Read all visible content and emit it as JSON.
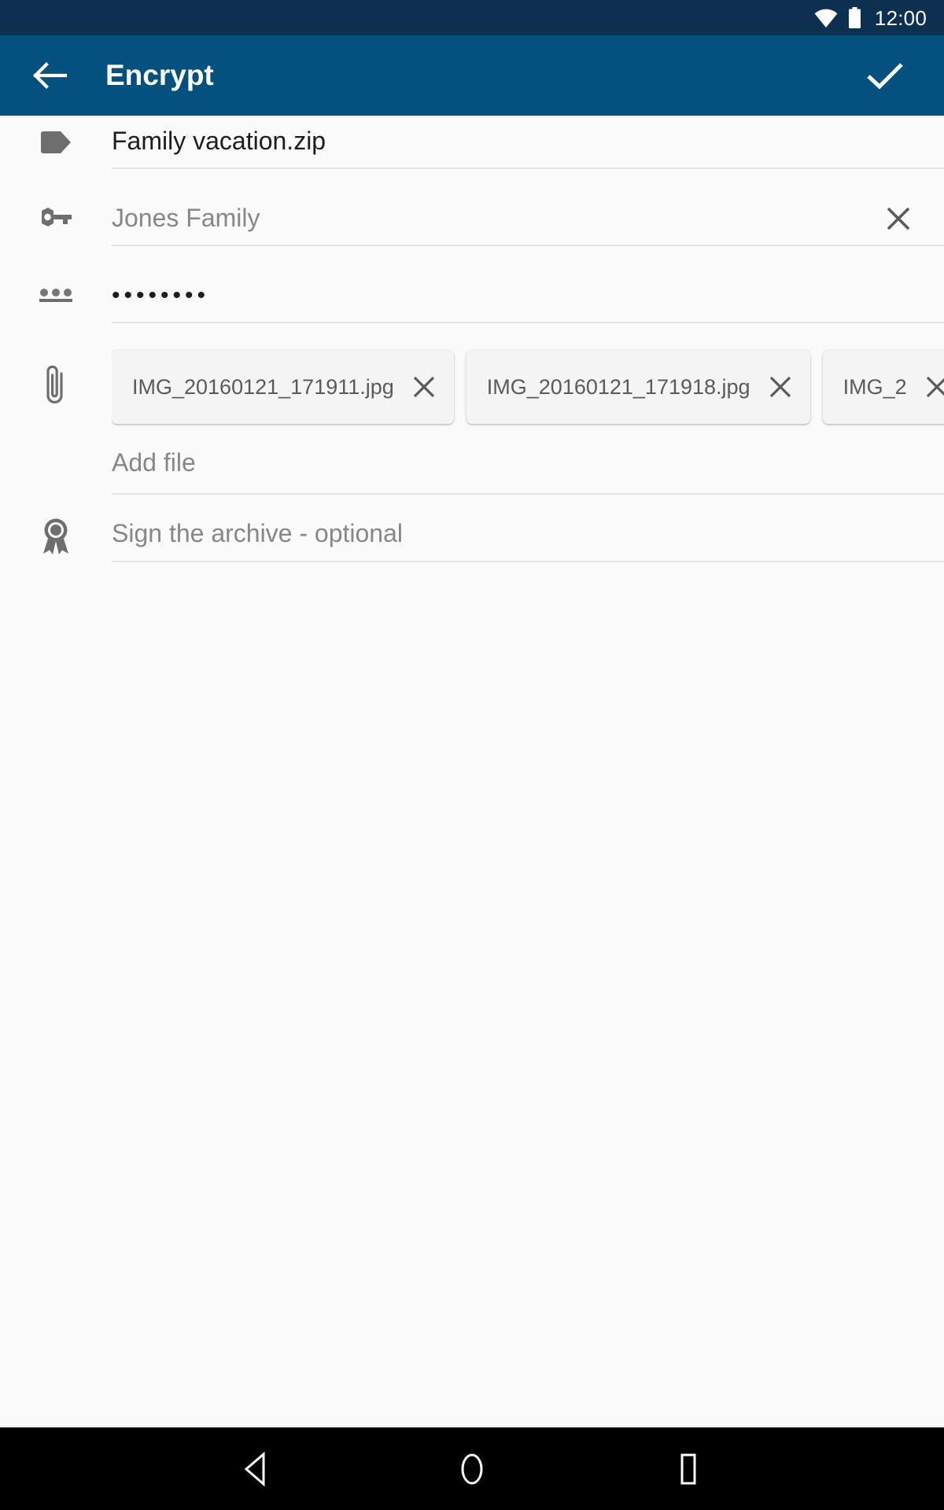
{
  "status_bar": {
    "time": "12:00",
    "wifi_icon": "wifi-icon",
    "battery_icon": "battery-icon",
    "background_color": "#0d3050"
  },
  "toolbar": {
    "title": "Encrypt",
    "back_icon": "arrow-back-icon",
    "confirm_icon": "check-icon",
    "background_color": "#04507f"
  },
  "form": {
    "archive_name": {
      "icon": "tag-icon",
      "value": "Family vacation.zip"
    },
    "key_name": {
      "icon": "key-icon",
      "value": "Jones Family",
      "clear_icon": "close-icon"
    },
    "password": {
      "icon": "password-dots-icon",
      "value": "••••••••"
    },
    "attachments": {
      "icon": "attachment-icon",
      "chips": [
        {
          "label": "IMG_20160121_171911.jpg",
          "remove_icon": "close-icon"
        },
        {
          "label": "IMG_20160121_171918.jpg",
          "remove_icon": "close-icon"
        },
        {
          "label": "IMG_2",
          "remove_icon": "close-icon"
        }
      ]
    },
    "add_file": {
      "label": "Add file"
    },
    "sign_archive": {
      "icon": "award-ribbon-icon",
      "label": "Sign the archive - optional"
    }
  },
  "nav_bar": {
    "back_icon": "nav-back-triangle-icon",
    "home_icon": "nav-home-circle-icon",
    "recents_icon": "nav-recents-square-icon",
    "background_color": "#000000"
  }
}
